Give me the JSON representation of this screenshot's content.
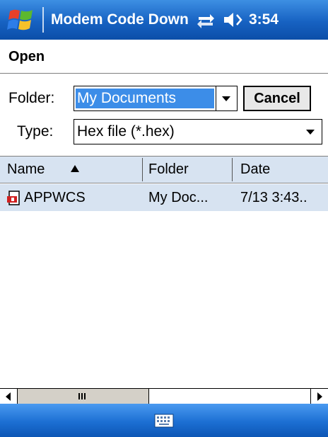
{
  "titlebar": {
    "app_title": "Modem Code Down",
    "time": "3:54",
    "icons": [
      "windows-start-icon",
      "connectivity-icon",
      "volume-icon"
    ]
  },
  "header": {
    "title": "Open"
  },
  "form": {
    "folder_label": "Folder:",
    "folder_value": "My Documents",
    "cancel_label": "Cancel",
    "type_label": "Type:",
    "type_value": "Hex file (*.hex)"
  },
  "list": {
    "columns": [
      {
        "label": "Name",
        "sorted": "ascending"
      },
      {
        "label": "Folder"
      },
      {
        "label": "Date"
      }
    ],
    "rows": [
      {
        "name": "APPWCS",
        "folder": "My Doc...",
        "date": "7/13 3:43..",
        "icon": "file-icon"
      }
    ]
  },
  "bottom": {
    "icon": "keyboard-icon"
  },
  "colors": {
    "titlebar": "#1762c2",
    "selection": "#3c8de8",
    "row_highlight": "#d7e3f1"
  }
}
